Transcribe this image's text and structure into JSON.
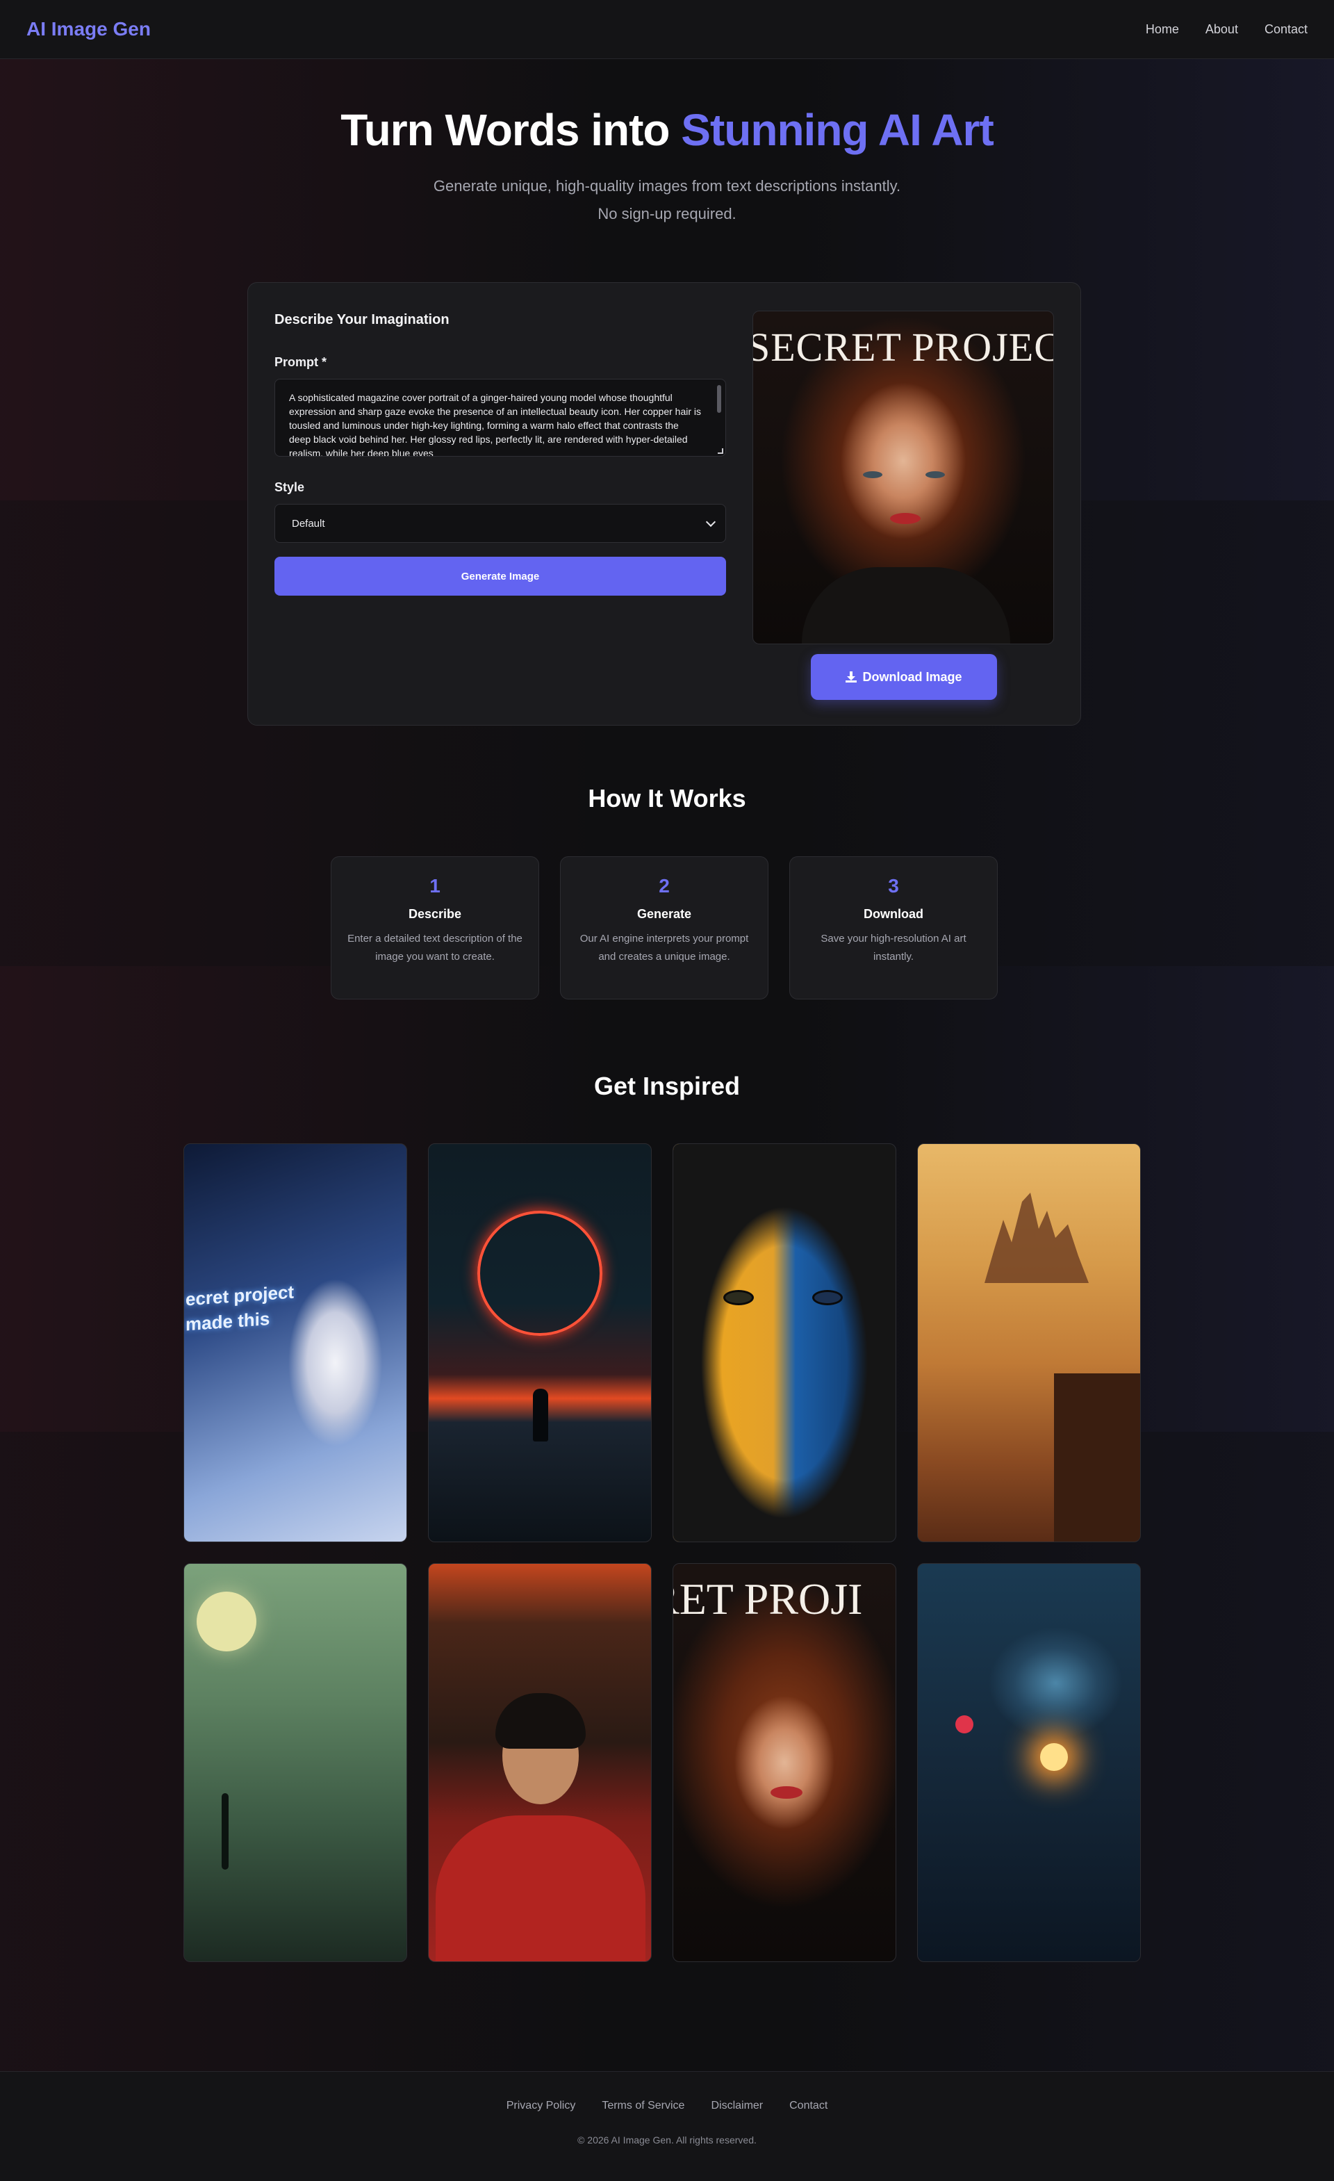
{
  "header": {
    "logo": "AI Image Gen",
    "nav": [
      "Home",
      "About",
      "Contact"
    ]
  },
  "hero": {
    "title_lead": "Turn Words into ",
    "title_accent": "Stunning AI Art",
    "subtitle": "Generate unique, high-quality images from text descriptions instantly. No sign-up required."
  },
  "generator": {
    "card_title": "Describe Your Imagination",
    "prompt_label": "Prompt *",
    "prompt_value": "A sophisticated magazine cover portrait of a ginger-haired young model whose thoughtful expression and sharp gaze evoke the presence of an intellectual beauty icon. Her copper hair is tousled and luminous under high-key lighting, forming a warm halo effect that contrasts the deep black void behind her. Her glossy red lips, perfectly lit, are rendered with hyper-detailed realism, while her deep blue eyes",
    "style_label": "Style",
    "style_value": "Default",
    "generate_label": "Generate Image",
    "result_cover_title": "SECRET PROJECT",
    "download_label": "Download Image"
  },
  "how_it_works": {
    "title": "How It Works",
    "steps": [
      {
        "num": "1",
        "name": "Describe",
        "desc": "Enter a detailed text description of the image you want to create."
      },
      {
        "num": "2",
        "name": "Generate",
        "desc": "Our AI engine interprets your prompt and creates a unique image."
      },
      {
        "num": "3",
        "name": "Download",
        "desc": "Save your high-resolution AI art instantly."
      }
    ]
  },
  "inspiration": {
    "title": "Get Inspired",
    "tile1_text": [
      "ecret project",
      "made this"
    ],
    "tile7_title": "RET PROJI"
  },
  "icons": {
    "download": "download-icon",
    "select": "chevron-down-icon"
  },
  "colors": {
    "accent": "#6364f1",
    "background": "#0f0f11",
    "card": "#1b1b1e"
  },
  "footer": {
    "links": [
      "Privacy Policy",
      "Terms of Service",
      "Disclaimer",
      "Contact"
    ],
    "copyright": "© 2026 AI Image Gen. All rights reserved."
  }
}
